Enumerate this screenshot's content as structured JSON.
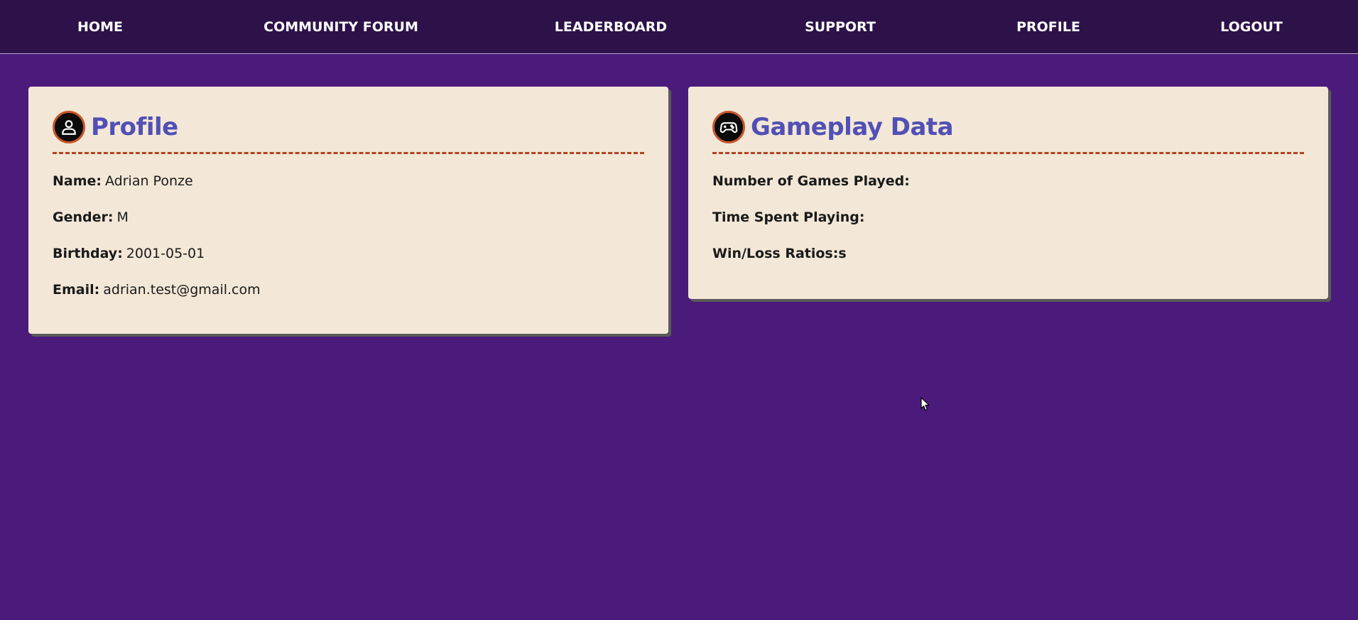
{
  "nav": {
    "items": [
      {
        "label": "HOME"
      },
      {
        "label": "COMMUNITY FORUM"
      },
      {
        "label": "LEADERBOARD"
      },
      {
        "label": "SUPPORT"
      },
      {
        "label": "PROFILE"
      },
      {
        "label": "LOGOUT"
      }
    ]
  },
  "profile_card": {
    "title": "Profile",
    "icon": "user-icon",
    "fields": [
      {
        "label": "Name:",
        "value": "Adrian Ponze"
      },
      {
        "label": "Gender:",
        "value": "M"
      },
      {
        "label": "Birthday:",
        "value": "2001-05-01"
      },
      {
        "label": "Email:",
        "value": "adrian.test@gmail.com"
      }
    ]
  },
  "gameplay_card": {
    "title": "Gameplay Data",
    "icon": "gamepad-icon",
    "fields": [
      {
        "label": "Number of Games Played:",
        "value": ""
      },
      {
        "label": "Time Spent Playing:",
        "value": ""
      },
      {
        "label": "Win/Loss Ratios:s",
        "value": ""
      }
    ]
  },
  "colors": {
    "background": "#4a1b7a",
    "navbar": "#2c1249",
    "card": "#f3e7d7",
    "title": "#5150b5",
    "rule": "#b3431f",
    "icon_ring": "#c7562c"
  }
}
